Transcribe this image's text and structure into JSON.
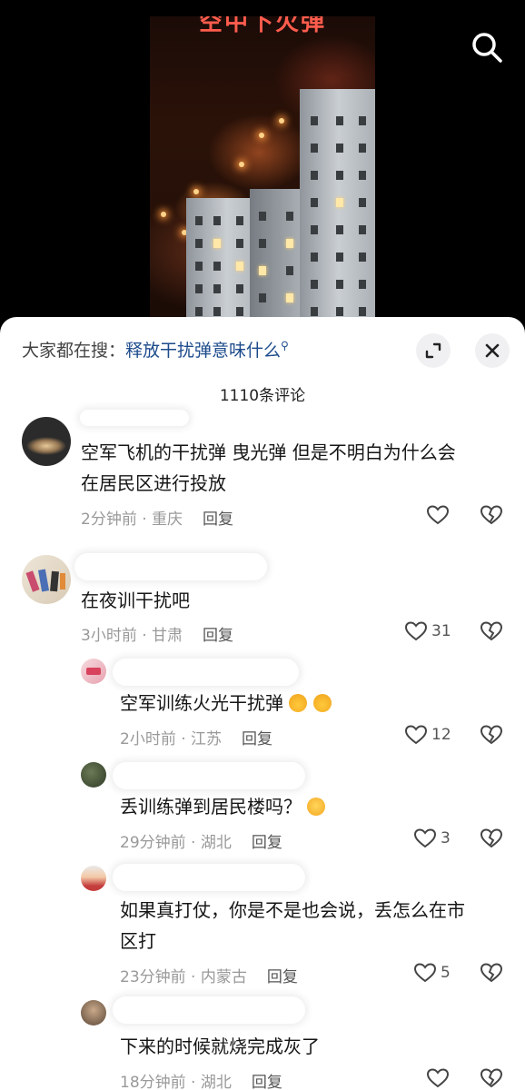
{
  "video": {
    "title": "空中下火弹"
  },
  "icons": {
    "search": "search-icon",
    "expand": "expand-icon",
    "close": "close-icon",
    "heart": "heart-icon",
    "broken_heart": "broken-heart-icon"
  },
  "sheet": {
    "suggest_prefix": "大家都在搜：",
    "suggest_query": "释放干扰弹意味什么",
    "comment_count": "1110条评论"
  },
  "comments": [
    {
      "text_lines": [
        "空军飞机的干扰弹 曳光弹  但是不明白为什么会",
        "在居民区进行投放"
      ],
      "time_loc": "2分钟前 · 重庆",
      "reply_label": "回复",
      "likes": ""
    },
    {
      "text_lines": [
        "在夜训干扰吧"
      ],
      "time_loc": "3小时前 · 甘肃",
      "reply_label": "回复",
      "likes": "31"
    },
    {
      "text_lines": [
        "空军训练火光干扰弹"
      ],
      "time_loc": "2小时前 · 江苏",
      "reply_label": "回复",
      "likes": "12"
    },
    {
      "text_lines": [
        "丢训练弹到居民楼吗？"
      ],
      "time_loc": "29分钟前 · 湖北",
      "reply_label": "回复",
      "likes": "3"
    },
    {
      "text_lines": [
        "如果真打仗，你是不是也会说，丢怎么在市",
        "区打"
      ],
      "time_loc": "23分钟前 · 内蒙古",
      "reply_label": "回复",
      "likes": "5"
    },
    {
      "text_lines": [
        "下来的时候就烧完成灰了"
      ],
      "time_loc": "18分钟前 · 湖北",
      "reply_label": "回复",
      "likes": ""
    }
  ]
}
